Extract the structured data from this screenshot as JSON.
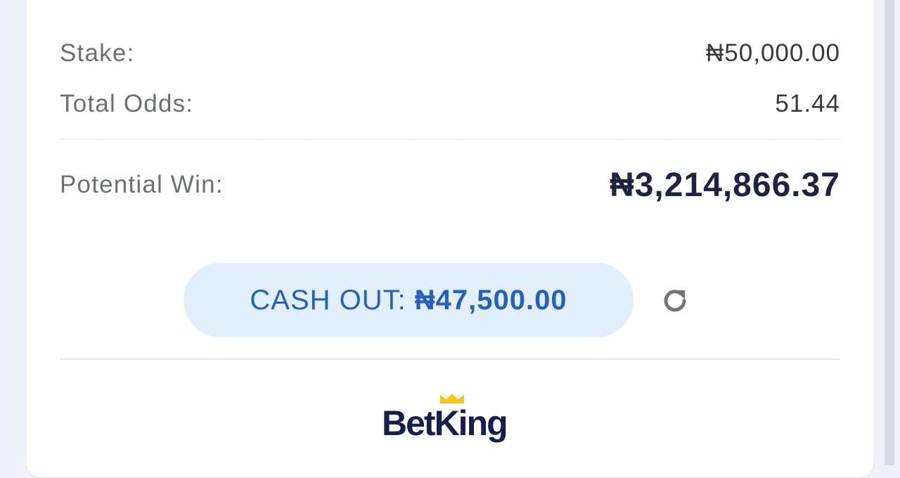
{
  "bet_summary": {
    "stake_label": "Stake:",
    "stake_value": "₦50,000.00",
    "odds_label": "Total Odds:",
    "odds_value": "51.44",
    "win_label": "Potential Win:",
    "win_value": "₦3,214,866.37"
  },
  "cashout": {
    "label": "CASH OUT:",
    "amount": "₦47,500.00",
    "refresh_icon": "refresh-icon"
  },
  "brand": {
    "name": "BetKing",
    "primary_color": "#14204a",
    "crown_color": "#f5c518"
  },
  "colors": {
    "cashout_bg": "#e1eefb",
    "cashout_text": "#2760b8"
  }
}
